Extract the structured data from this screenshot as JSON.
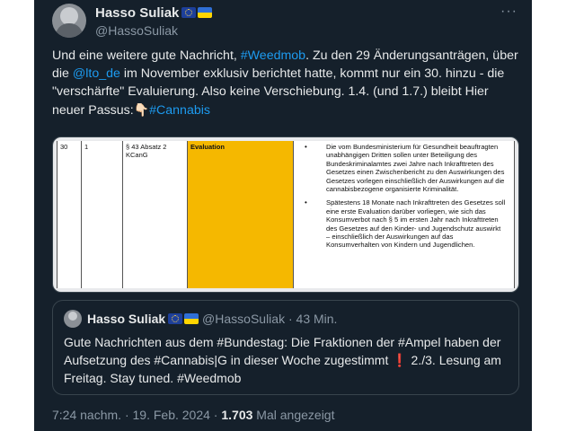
{
  "author": {
    "name": "Hasso Suliak",
    "handle": "@HassoSuliak"
  },
  "more_label": "···",
  "tweet": {
    "text_1": "Und eine weitere gute  Nachricht, ",
    "hashtag_weedmob": "#Weedmob",
    "text_2": ". Zu den 29 Änderungsanträgen, über die ",
    "mention_lto": "@lto_de",
    "text_3": " im November exklusiv berichtet hatte, kommt nur ein 30. hinzu - die \"verschärfte\" Evaluierung. Also keine Verschiebung. 1.4. (und 1.7.) bleibt Hier neuer Passus:",
    "pointer_emoji": "👇🏻",
    "hashtag_cannabis": "#Cannabis"
  },
  "document": {
    "row_number": "30",
    "col_two": "1",
    "paragraph": "§ 43 Absatz 2 KCanG",
    "heading": "Evaluation",
    "bullet_1": "Die vom Bundesministerium für Gesundheit beauftragten unabhängigen Dritten sollen unter Beteiligung des Bundeskriminalamtes zwei Jahre nach Inkrafttreten des Gesetzes einen Zwischenbericht zu den Auswirkungen des Gesetzes vorlegen einschließlich der Auswirkungen auf die cannabisbezogene organisierte Kriminalität.",
    "bullet_2": "Spätestens 18 Monate nach Inkrafttreten des Gesetzes soll eine erste Evaluation darüber vorliegen, wie sich das Konsumverbot nach § 5 im ersten Jahr nach Inkrafttreten des Gesetzes auf den Kinder- und Jugendschutz auswirkt – einschließlich der Auswirkungen auf das Konsumverhalten von Kindern und Jugendlichen."
  },
  "quote": {
    "name": "Hasso Suliak",
    "handle": "@HassoSuliak",
    "separator": " · ",
    "time": "43 Min.",
    "text_1": "Gute Nachrichten aus dem #Bundestag: Die Fraktionen der #Ampel haben der Aufsetzung des #Cannabis|G in dieser Woche zugestimmt ",
    "exclaim": "❗",
    "text_2": " 2./3. Lesung am Freitag. Stay tuned. #Weedmob"
  },
  "footer": {
    "time": "7:24 nachm.",
    "dot": " · ",
    "date": "19. Feb. 2024",
    "views_count": "1.703",
    "views_label": " Mal angezeigt"
  },
  "colors": {
    "background": "#15202b",
    "link": "#1d9bf0",
    "highlight": "#f5b800"
  }
}
